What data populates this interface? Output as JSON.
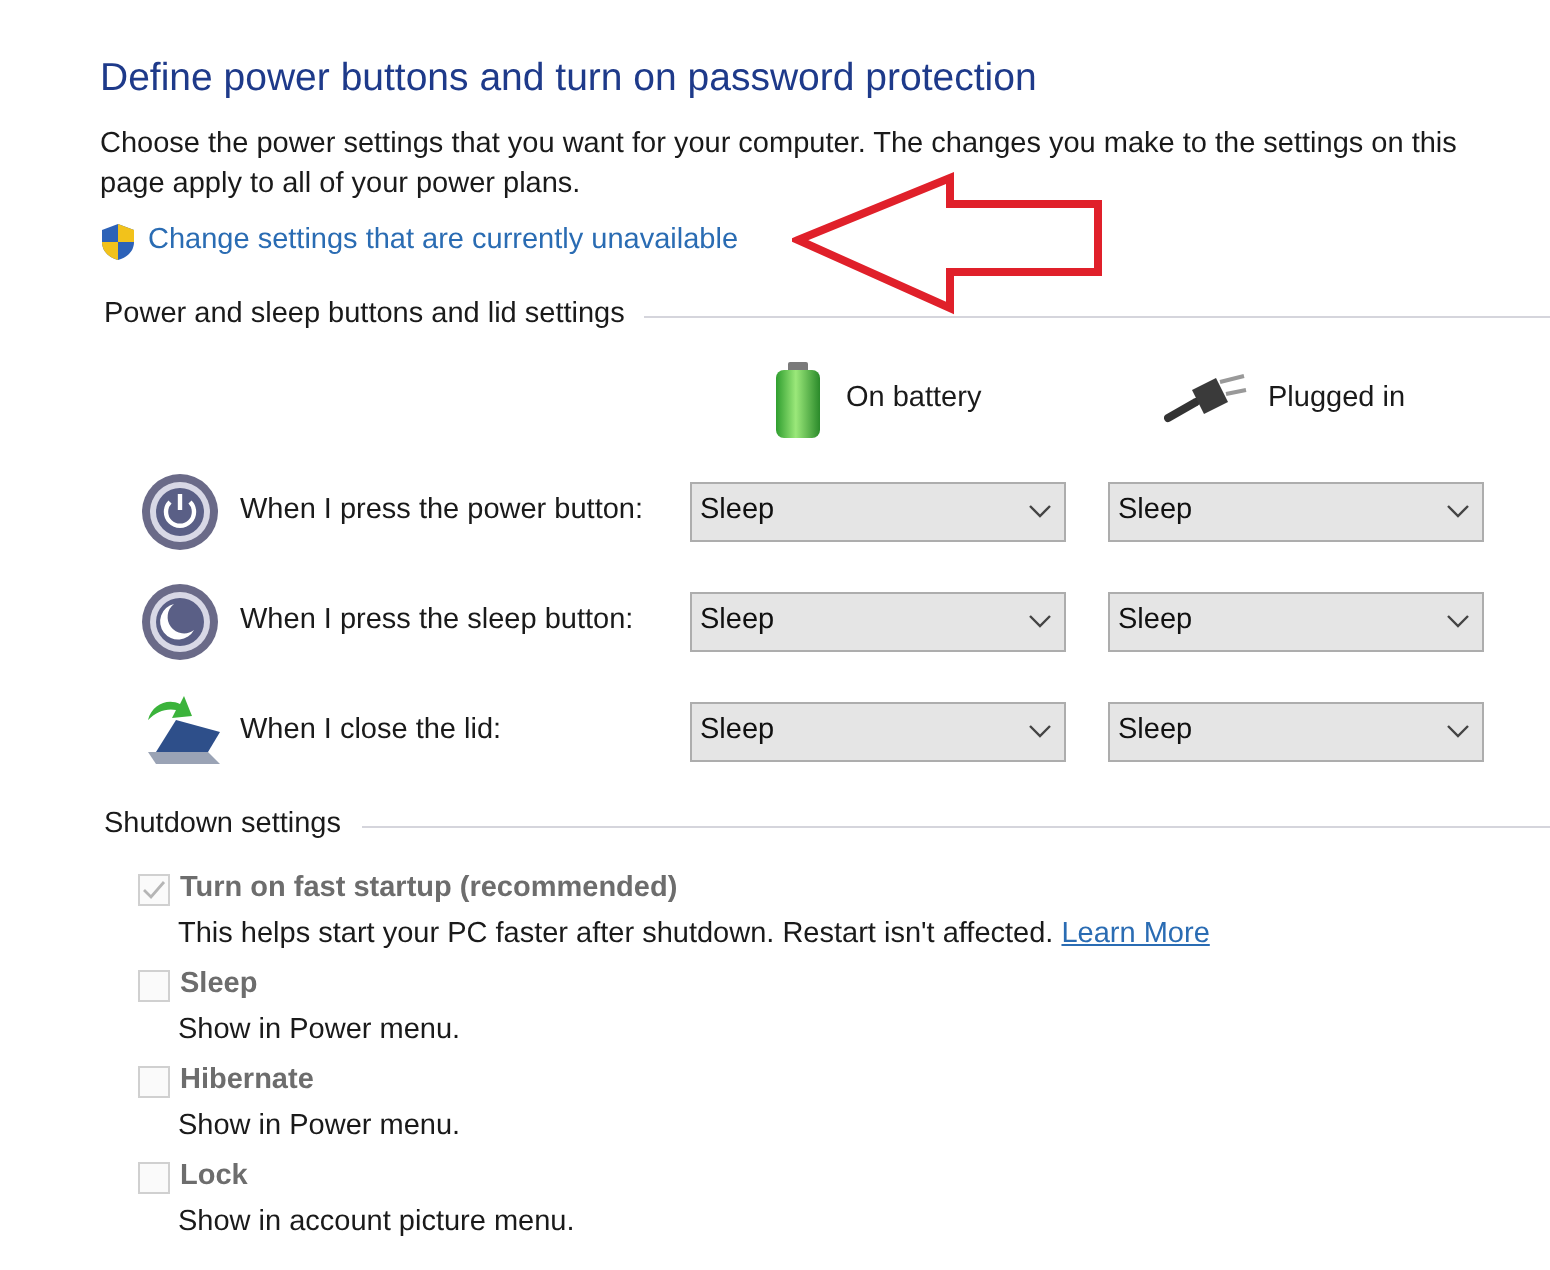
{
  "title": "Define power buttons and turn on password protection",
  "intro": "Choose the power settings that you want for your computer. The changes you make to the settings on this page apply to all of your power plans.",
  "admin_link": "Change settings that are currently unavailable",
  "button_settings": {
    "heading": "Power and sleep buttons and lid settings",
    "columns": [
      {
        "label": "On battery",
        "kind": "battery"
      },
      {
        "label": "Plugged in",
        "kind": "plug"
      }
    ],
    "rows": [
      {
        "label": "When I press the power button:",
        "kind": "power",
        "values": [
          "Sleep",
          "Sleep"
        ]
      },
      {
        "label": "When I press the sleep button:",
        "kind": "sleep",
        "values": [
          "Sleep",
          "Sleep"
        ]
      },
      {
        "label": "When I close the lid:",
        "kind": "lid",
        "values": [
          "Sleep",
          "Sleep"
        ]
      }
    ]
  },
  "shutdown_settings": {
    "heading": "Shutdown settings",
    "options": [
      {
        "label": "Turn on fast startup (recommended)",
        "description": "This helps start your PC faster after shutdown. Restart isn't affected.",
        "link": "Learn More",
        "checked": true,
        "disabled": true
      },
      {
        "label": "Sleep",
        "description": "Show in Power menu.",
        "checked": false,
        "disabled": true
      },
      {
        "label": "Hibernate",
        "description": "Show in Power menu.",
        "checked": false,
        "disabled": true
      },
      {
        "label": "Lock",
        "description": "Show in account picture menu.",
        "checked": false,
        "disabled": true
      }
    ]
  }
}
